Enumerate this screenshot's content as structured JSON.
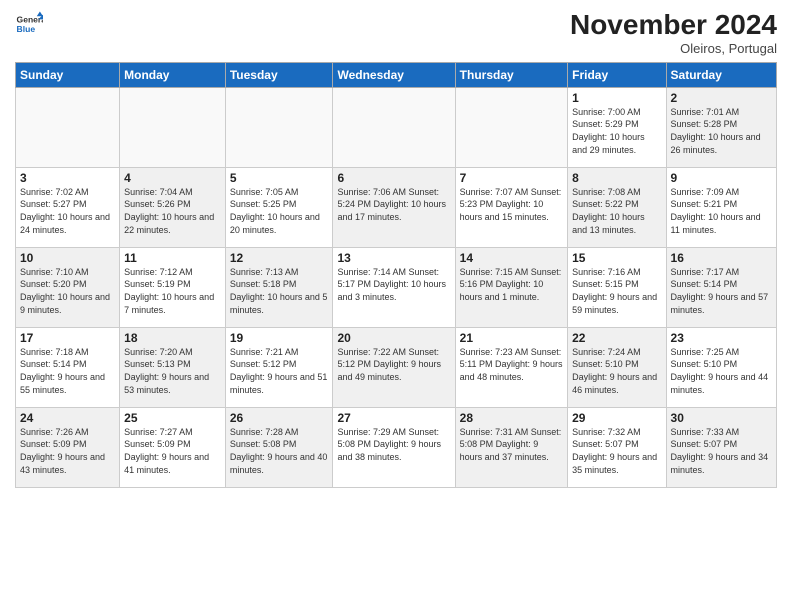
{
  "header": {
    "logo_line1": "General",
    "logo_line2": "Blue",
    "month": "November 2024",
    "location": "Oleiros, Portugal"
  },
  "weekdays": [
    "Sunday",
    "Monday",
    "Tuesday",
    "Wednesday",
    "Thursday",
    "Friday",
    "Saturday"
  ],
  "weeks": [
    [
      {
        "day": "",
        "info": ""
      },
      {
        "day": "",
        "info": ""
      },
      {
        "day": "",
        "info": ""
      },
      {
        "day": "",
        "info": ""
      },
      {
        "day": "",
        "info": ""
      },
      {
        "day": "1",
        "info": "Sunrise: 7:00 AM\nSunset: 5:29 PM\nDaylight: 10 hours\nand 29 minutes."
      },
      {
        "day": "2",
        "info": "Sunrise: 7:01 AM\nSunset: 5:28 PM\nDaylight: 10 hours\nand 26 minutes."
      }
    ],
    [
      {
        "day": "3",
        "info": "Sunrise: 7:02 AM\nSunset: 5:27 PM\nDaylight: 10 hours\nand 24 minutes."
      },
      {
        "day": "4",
        "info": "Sunrise: 7:04 AM\nSunset: 5:26 PM\nDaylight: 10 hours\nand 22 minutes."
      },
      {
        "day": "5",
        "info": "Sunrise: 7:05 AM\nSunset: 5:25 PM\nDaylight: 10 hours\nand 20 minutes."
      },
      {
        "day": "6",
        "info": "Sunrise: 7:06 AM\nSunset: 5:24 PM\nDaylight: 10 hours\nand 17 minutes."
      },
      {
        "day": "7",
        "info": "Sunrise: 7:07 AM\nSunset: 5:23 PM\nDaylight: 10 hours\nand 15 minutes."
      },
      {
        "day": "8",
        "info": "Sunrise: 7:08 AM\nSunset: 5:22 PM\nDaylight: 10 hours\nand 13 minutes."
      },
      {
        "day": "9",
        "info": "Sunrise: 7:09 AM\nSunset: 5:21 PM\nDaylight: 10 hours\nand 11 minutes."
      }
    ],
    [
      {
        "day": "10",
        "info": "Sunrise: 7:10 AM\nSunset: 5:20 PM\nDaylight: 10 hours\nand 9 minutes."
      },
      {
        "day": "11",
        "info": "Sunrise: 7:12 AM\nSunset: 5:19 PM\nDaylight: 10 hours\nand 7 minutes."
      },
      {
        "day": "12",
        "info": "Sunrise: 7:13 AM\nSunset: 5:18 PM\nDaylight: 10 hours\nand 5 minutes."
      },
      {
        "day": "13",
        "info": "Sunrise: 7:14 AM\nSunset: 5:17 PM\nDaylight: 10 hours\nand 3 minutes."
      },
      {
        "day": "14",
        "info": "Sunrise: 7:15 AM\nSunset: 5:16 PM\nDaylight: 10 hours\nand 1 minute."
      },
      {
        "day": "15",
        "info": "Sunrise: 7:16 AM\nSunset: 5:15 PM\nDaylight: 9 hours\nand 59 minutes."
      },
      {
        "day": "16",
        "info": "Sunrise: 7:17 AM\nSunset: 5:14 PM\nDaylight: 9 hours\nand 57 minutes."
      }
    ],
    [
      {
        "day": "17",
        "info": "Sunrise: 7:18 AM\nSunset: 5:14 PM\nDaylight: 9 hours\nand 55 minutes."
      },
      {
        "day": "18",
        "info": "Sunrise: 7:20 AM\nSunset: 5:13 PM\nDaylight: 9 hours\nand 53 minutes."
      },
      {
        "day": "19",
        "info": "Sunrise: 7:21 AM\nSunset: 5:12 PM\nDaylight: 9 hours\nand 51 minutes."
      },
      {
        "day": "20",
        "info": "Sunrise: 7:22 AM\nSunset: 5:12 PM\nDaylight: 9 hours\nand 49 minutes."
      },
      {
        "day": "21",
        "info": "Sunrise: 7:23 AM\nSunset: 5:11 PM\nDaylight: 9 hours\nand 48 minutes."
      },
      {
        "day": "22",
        "info": "Sunrise: 7:24 AM\nSunset: 5:10 PM\nDaylight: 9 hours\nand 46 minutes."
      },
      {
        "day": "23",
        "info": "Sunrise: 7:25 AM\nSunset: 5:10 PM\nDaylight: 9 hours\nand 44 minutes."
      }
    ],
    [
      {
        "day": "24",
        "info": "Sunrise: 7:26 AM\nSunset: 5:09 PM\nDaylight: 9 hours\nand 43 minutes."
      },
      {
        "day": "25",
        "info": "Sunrise: 7:27 AM\nSunset: 5:09 PM\nDaylight: 9 hours\nand 41 minutes."
      },
      {
        "day": "26",
        "info": "Sunrise: 7:28 AM\nSunset: 5:08 PM\nDaylight: 9 hours\nand 40 minutes."
      },
      {
        "day": "27",
        "info": "Sunrise: 7:29 AM\nSunset: 5:08 PM\nDaylight: 9 hours\nand 38 minutes."
      },
      {
        "day": "28",
        "info": "Sunrise: 7:31 AM\nSunset: 5:08 PM\nDaylight: 9 hours\nand 37 minutes."
      },
      {
        "day": "29",
        "info": "Sunrise: 7:32 AM\nSunset: 5:07 PM\nDaylight: 9 hours\nand 35 minutes."
      },
      {
        "day": "30",
        "info": "Sunrise: 7:33 AM\nSunset: 5:07 PM\nDaylight: 9 hours\nand 34 minutes."
      }
    ]
  ]
}
